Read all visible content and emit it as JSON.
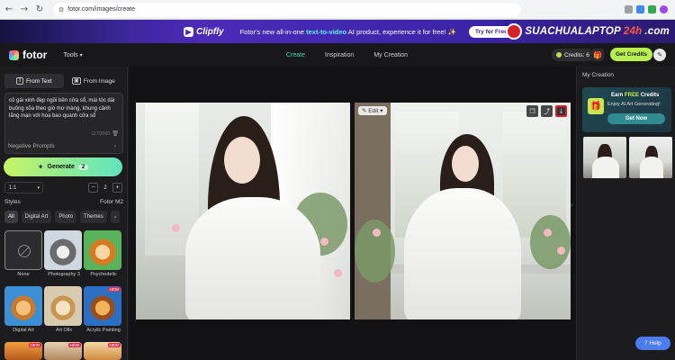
{
  "browser": {
    "url": "fotor.com/images/create"
  },
  "banner": {
    "brand": "Clipfly",
    "text_pre": "Fotor's new all-in-one ",
    "text_highlight": "text-to-video",
    "text_post": " AI product, experience it for free! ✨",
    "cta": "Try for Free",
    "watermark_a": "SUACHUALAPTOP",
    "watermark_b": "24h",
    "watermark_c": ".com"
  },
  "header": {
    "logo": "fotor",
    "tools": "Tools",
    "tabs": [
      {
        "label": "Create",
        "active": true
      },
      {
        "label": "Inspiration",
        "active": false
      },
      {
        "label": "My Creation",
        "active": false
      }
    ],
    "credits_label": "Credits: 6",
    "get_credits": "Get Credits"
  },
  "left": {
    "mode_tabs": [
      {
        "label": "From Text",
        "active": true
      },
      {
        "label": "From Image",
        "active": false
      }
    ],
    "prompt": "cô gái xinh đẹp ngồi bên cửa sổ, mái tóc dài buông xõa theo gió mơ màng, khung cảnh lãng mạn với hoa bao quanh cửa sổ",
    "prompt_count": "117/2000",
    "negative_prompts": "Negative Prompts",
    "generate": "Generate",
    "generate_cost": "2",
    "ratio": "1:1",
    "count": "2",
    "styles_label": "Styles",
    "model": "Fotor M2",
    "chips": [
      "All",
      "Digital Art",
      "Photo",
      "Themes"
    ],
    "styles": [
      {
        "label": "None",
        "new": false
      },
      {
        "label": "Photography 3",
        "new": false
      },
      {
        "label": "Psychedelic",
        "new": false
      },
      {
        "label": "Digital Art",
        "new": false
      },
      {
        "label": "Art Oils",
        "new": false
      },
      {
        "label": "Acrylic Painting",
        "new": true
      }
    ],
    "new_badge": "NEW"
  },
  "canvas": {
    "edit_label": "Edit"
  },
  "right": {
    "title": "My Creation",
    "earn_a": "Earn ",
    "earn_free": "FREE",
    "earn_b": " Credits",
    "earn_sub": "Enjoy AI Art Generating!",
    "get_now": "Get Now"
  },
  "help": "Help",
  "colors": {
    "accent": "#35d6a5",
    "generate_start": "#c7f464",
    "generate_end": "#5fe3c0",
    "highlight_box": "#e51b23"
  }
}
